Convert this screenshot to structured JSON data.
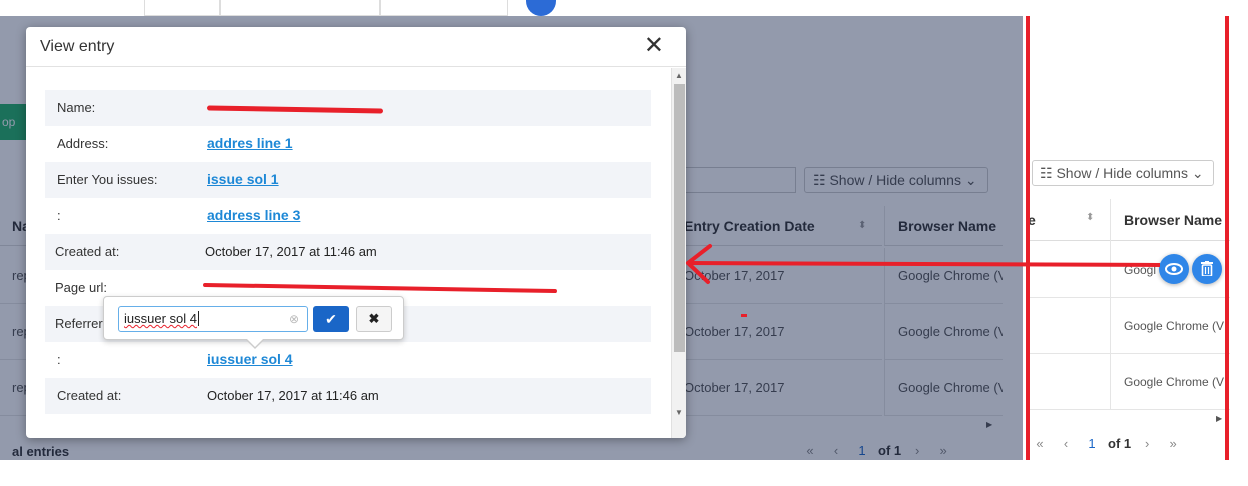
{
  "modal": {
    "title": "View entry",
    "close_glyph": "✕",
    "rows": [
      {
        "label": "Name:",
        "value": "",
        "link": true,
        "redacted": true
      },
      {
        "label": "Address:",
        "value": "addres line 1",
        "link": true
      },
      {
        "label": "Enter You issues:",
        "value": "issue sol 1",
        "link": true
      },
      {
        "label": ":",
        "value": "address line 3",
        "link": true
      },
      {
        "label": "Created at:",
        "value": "October 17, 2017 at 11:46 am",
        "link": false
      },
      {
        "label": "Page url:",
        "value": "",
        "link": false,
        "redacted": true
      },
      {
        "label": "Referrer",
        "value": "",
        "link": false
      },
      {
        "label": ":",
        "value": "iussuer sol 4",
        "link": true
      },
      {
        "label": "Created at:",
        "value": "October 17, 2017 at 11:46 am",
        "link": false
      }
    ]
  },
  "popup": {
    "input_value": "iussuer sol 4",
    "clear_glyph": "⊗",
    "ok_glyph": "✔",
    "cancel_glyph": "✖"
  },
  "background": {
    "green_button_label": "ор",
    "show_hide_label": "☷ Show / Hide columns ⌄",
    "table": {
      "col_left_header": "Na",
      "col_entry_header": "Entry Creation Date",
      "col_browser_header": "Browser Name",
      "row_left_text": "rep",
      "rows_entry": [
        "October 17, 2017",
        "October 17, 2017",
        "October 17, 2017"
      ],
      "rows_browser": [
        "Google Chrome (V",
        "Google Chrome (V",
        "Google Chrome (V"
      ]
    },
    "footer_entries": "al entries",
    "pager": {
      "first": "«",
      "prev": "‹",
      "page": "1",
      "of": "of 1",
      "next": "›",
      "last": "»"
    }
  },
  "right_panel": {
    "show_hide_label": "☷ Show / Hide columns ⌄",
    "col_left_header": "e",
    "col_browser_header": "Browser Name",
    "rows_browser": [
      "Googl",
      "Google Chrome (V",
      "Google Chrome (V"
    ],
    "view_icon_glyph": "👁",
    "delete_icon_glyph": "🗑",
    "pager": {
      "first": "«",
      "prev": "‹",
      "page": "1",
      "of": "of 1",
      "next": "›",
      "last": "»"
    }
  },
  "colors": {
    "annotation_red": "#e8202a",
    "link_blue": "#1e88d6",
    "primary_blue": "#1a66c7",
    "overlay": "#0f1e46"
  }
}
